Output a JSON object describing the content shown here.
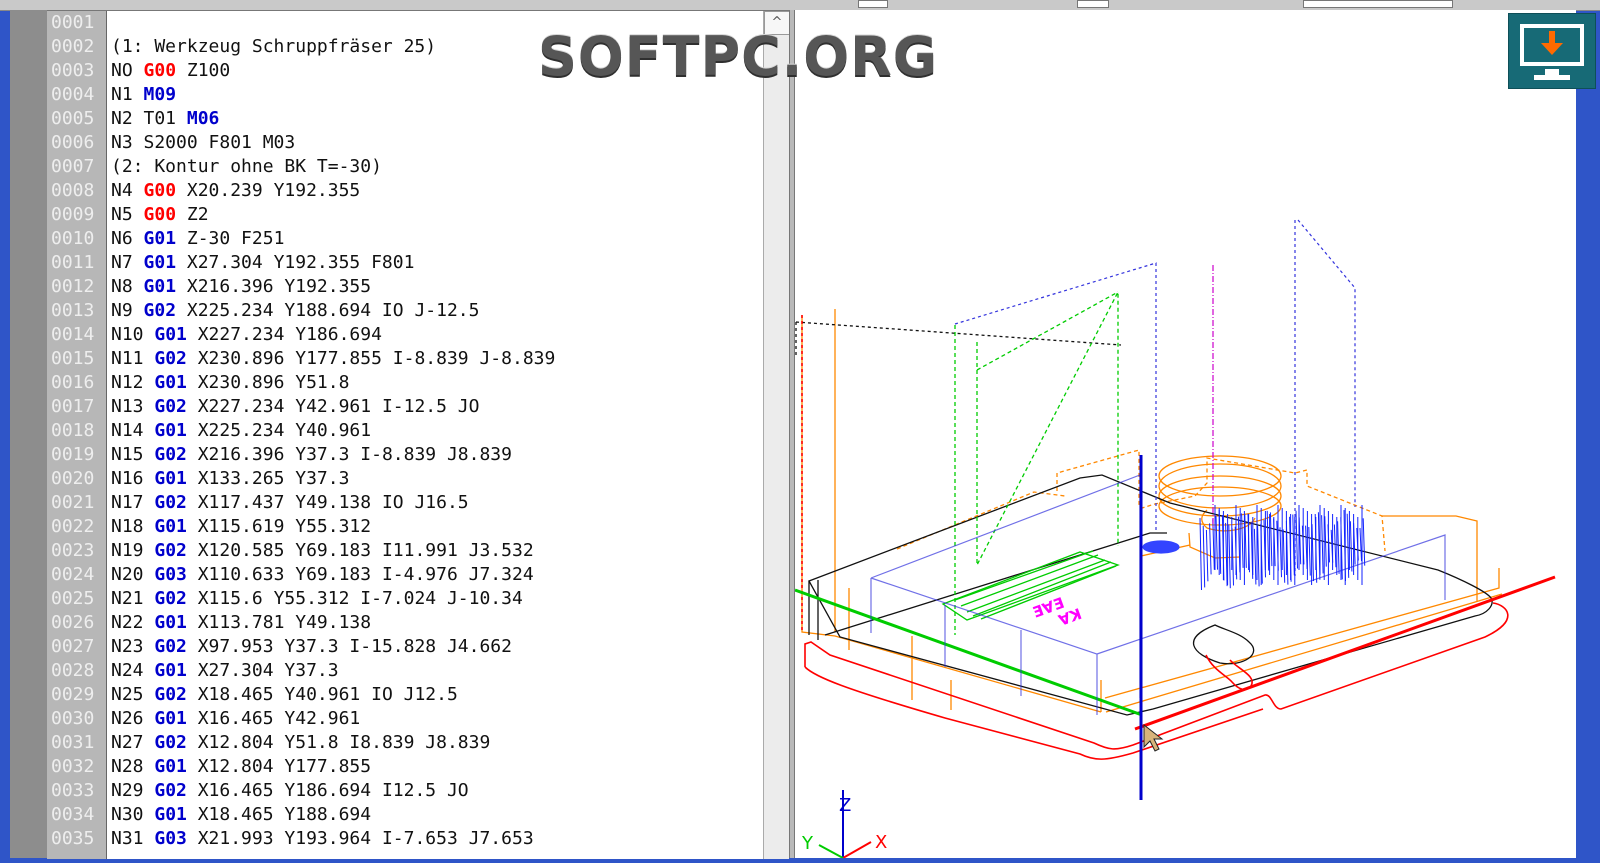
{
  "watermark": {
    "text": "SOFTPC.ORG"
  },
  "editor": {
    "scroll_icon": "^",
    "lines": [
      {
        "n": "0001",
        "parts": []
      },
      {
        "n": "0002",
        "parts": [
          {
            "t": "(1: Werkzeug Schruppfräser 25)",
            "c": "plain"
          }
        ]
      },
      {
        "n": "0003",
        "parts": [
          {
            "t": "NO ",
            "c": "plain"
          },
          {
            "t": "G00",
            "c": "red"
          },
          {
            "t": " Z100",
            "c": "plain"
          }
        ]
      },
      {
        "n": "0004",
        "parts": [
          {
            "t": "N1 ",
            "c": "plain"
          },
          {
            "t": "M09",
            "c": "blue"
          }
        ]
      },
      {
        "n": "0005",
        "parts": [
          {
            "t": "N2 T01 ",
            "c": "plain"
          },
          {
            "t": "M06",
            "c": "blue"
          }
        ]
      },
      {
        "n": "0006",
        "parts": [
          {
            "t": "N3 S2000 F801 M03",
            "c": "plain"
          }
        ]
      },
      {
        "n": "0007",
        "parts": [
          {
            "t": "(2: Kontur ohne BK T=-30)",
            "c": "plain"
          }
        ]
      },
      {
        "n": "0008",
        "parts": [
          {
            "t": "N4 ",
            "c": "plain"
          },
          {
            "t": "G00",
            "c": "red"
          },
          {
            "t": " X20.239 Y192.355",
            "c": "plain"
          }
        ]
      },
      {
        "n": "0009",
        "parts": [
          {
            "t": "N5 ",
            "c": "plain"
          },
          {
            "t": "G00",
            "c": "red"
          },
          {
            "t": " Z2",
            "c": "plain"
          }
        ]
      },
      {
        "n": "0010",
        "parts": [
          {
            "t": "N6 ",
            "c": "plain"
          },
          {
            "t": "G01",
            "c": "blue"
          },
          {
            "t": " Z-30 F251",
            "c": "plain"
          }
        ]
      },
      {
        "n": "0011",
        "parts": [
          {
            "t": "N7 ",
            "c": "plain"
          },
          {
            "t": "G01",
            "c": "blue"
          },
          {
            "t": " X27.304 Y192.355 F801",
            "c": "plain"
          }
        ]
      },
      {
        "n": "0012",
        "parts": [
          {
            "t": "N8 ",
            "c": "plain"
          },
          {
            "t": "G01",
            "c": "blue"
          },
          {
            "t": " X216.396 Y192.355",
            "c": "plain"
          }
        ]
      },
      {
        "n": "0013",
        "parts": [
          {
            "t": "N9 ",
            "c": "plain"
          },
          {
            "t": "G02",
            "c": "blue"
          },
          {
            "t": " X225.234 Y188.694 IO J-12.5",
            "c": "plain"
          }
        ]
      },
      {
        "n": "0014",
        "parts": [
          {
            "t": "N10 ",
            "c": "plain"
          },
          {
            "t": "G01",
            "c": "blue"
          },
          {
            "t": " X227.234 Y186.694",
            "c": "plain"
          }
        ]
      },
      {
        "n": "0015",
        "parts": [
          {
            "t": "N11 ",
            "c": "plain"
          },
          {
            "t": "G02",
            "c": "blue"
          },
          {
            "t": " X230.896 Y177.855 I-8.839 J-8.839",
            "c": "plain"
          }
        ]
      },
      {
        "n": "0016",
        "parts": [
          {
            "t": "N12 ",
            "c": "plain"
          },
          {
            "t": "G01",
            "c": "blue"
          },
          {
            "t": " X230.896 Y51.8",
            "c": "plain"
          }
        ]
      },
      {
        "n": "0017",
        "parts": [
          {
            "t": "N13 ",
            "c": "plain"
          },
          {
            "t": "G02",
            "c": "blue"
          },
          {
            "t": " X227.234 Y42.961 I-12.5 JO",
            "c": "plain"
          }
        ]
      },
      {
        "n": "0018",
        "parts": [
          {
            "t": "N14 ",
            "c": "plain"
          },
          {
            "t": "G01",
            "c": "blue"
          },
          {
            "t": " X225.234 Y40.961",
            "c": "plain"
          }
        ]
      },
      {
        "n": "0019",
        "parts": [
          {
            "t": "N15 ",
            "c": "plain"
          },
          {
            "t": "G02",
            "c": "blue"
          },
          {
            "t": " X216.396 Y37.3 I-8.839 J8.839",
            "c": "plain"
          }
        ]
      },
      {
        "n": "0020",
        "parts": [
          {
            "t": "N16 ",
            "c": "plain"
          },
          {
            "t": "G01",
            "c": "blue"
          },
          {
            "t": " X133.265 Y37.3",
            "c": "plain"
          }
        ]
      },
      {
        "n": "0021",
        "parts": [
          {
            "t": "N17 ",
            "c": "plain"
          },
          {
            "t": "G02",
            "c": "blue"
          },
          {
            "t": " X117.437 Y49.138 IO J16.5",
            "c": "plain"
          }
        ]
      },
      {
        "n": "0022",
        "parts": [
          {
            "t": "N18 ",
            "c": "plain"
          },
          {
            "t": "G01",
            "c": "blue"
          },
          {
            "t": " X115.619 Y55.312",
            "c": "plain"
          }
        ]
      },
      {
        "n": "0023",
        "parts": [
          {
            "t": "N19 ",
            "c": "plain"
          },
          {
            "t": "G02",
            "c": "blue"
          },
          {
            "t": " X120.585 Y69.183 I11.991 J3.532",
            "c": "plain"
          }
        ]
      },
      {
        "n": "0024",
        "parts": [
          {
            "t": "N20 ",
            "c": "plain"
          },
          {
            "t": "G03",
            "c": "blue"
          },
          {
            "t": " X110.633 Y69.183 I-4.976 J7.324",
            "c": "plain"
          }
        ]
      },
      {
        "n": "0025",
        "parts": [
          {
            "t": "N21 ",
            "c": "plain"
          },
          {
            "t": "G02",
            "c": "blue"
          },
          {
            "t": " X115.6 Y55.312 I-7.024 J-10.34",
            "c": "plain"
          }
        ]
      },
      {
        "n": "0026",
        "parts": [
          {
            "t": "N22 ",
            "c": "plain"
          },
          {
            "t": "G01",
            "c": "blue"
          },
          {
            "t": " X113.781 Y49.138",
            "c": "plain"
          }
        ]
      },
      {
        "n": "0027",
        "parts": [
          {
            "t": "N23 ",
            "c": "plain"
          },
          {
            "t": "G02",
            "c": "blue"
          },
          {
            "t": " X97.953 Y37.3 I-15.828 J4.662",
            "c": "plain"
          }
        ]
      },
      {
        "n": "0028",
        "parts": [
          {
            "t": "N24 ",
            "c": "plain"
          },
          {
            "t": "G01",
            "c": "blue"
          },
          {
            "t": " X27.304 Y37.3",
            "c": "plain"
          }
        ]
      },
      {
        "n": "0029",
        "parts": [
          {
            "t": "N25 ",
            "c": "plain"
          },
          {
            "t": "G02",
            "c": "blue"
          },
          {
            "t": " X18.465 Y40.961 IO J12.5",
            "c": "plain"
          }
        ]
      },
      {
        "n": "0030",
        "parts": [
          {
            "t": "N26 ",
            "c": "plain"
          },
          {
            "t": "G01",
            "c": "blue"
          },
          {
            "t": " X16.465 Y42.961",
            "c": "plain"
          }
        ]
      },
      {
        "n": "0031",
        "parts": [
          {
            "t": "N27 ",
            "c": "plain"
          },
          {
            "t": "G02",
            "c": "blue"
          },
          {
            "t": " X12.804 Y51.8 I8.839 J8.839",
            "c": "plain"
          }
        ]
      },
      {
        "n": "0032",
        "parts": [
          {
            "t": "N28 ",
            "c": "plain"
          },
          {
            "t": "G01",
            "c": "blue"
          },
          {
            "t": " X12.804 Y177.855",
            "c": "plain"
          }
        ]
      },
      {
        "n": "0033",
        "parts": [
          {
            "t": "N29 ",
            "c": "plain"
          },
          {
            "t": "G02",
            "c": "blue"
          },
          {
            "t": " X16.465 Y186.694 I12.5 JO",
            "c": "plain"
          }
        ]
      },
      {
        "n": "0034",
        "parts": [
          {
            "t": "N30 ",
            "c": "plain"
          },
          {
            "t": "G01",
            "c": "blue"
          },
          {
            "t": " X18.465 Y188.694",
            "c": "plain"
          }
        ]
      },
      {
        "n": "0035",
        "parts": [
          {
            "t": "N31 ",
            "c": "plain"
          },
          {
            "t": "G03",
            "c": "blue"
          },
          {
            "t": " X21.993 Y193.964 I-7.653 J7.653",
            "c": "plain"
          }
        ]
      }
    ]
  },
  "viewport": {
    "axis_labels": {
      "z": "Z",
      "y": "Y",
      "x": "X"
    },
    "colors": {
      "red": "#ff0000",
      "blue": "#0000cc",
      "green": "#00cc00",
      "magenta": "#cc00cc",
      "orange": "#ff8800"
    }
  },
  "download_icon": {
    "icon": "download-monitor-icon"
  }
}
